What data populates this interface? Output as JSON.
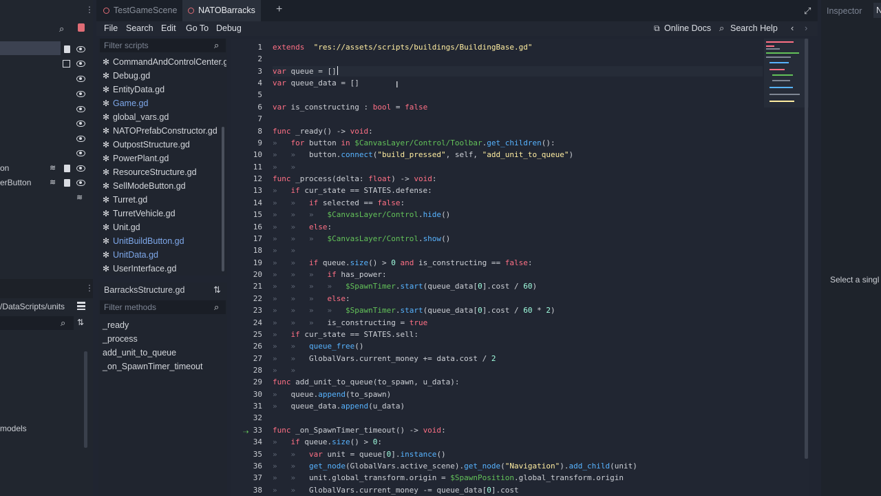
{
  "tabs": [
    {
      "label": "TestGameScene"
    },
    {
      "label": "NATOBarracks"
    }
  ],
  "menu": [
    "File",
    "Search",
    "Edit",
    "Go To",
    "Debug"
  ],
  "toolbar": {
    "online_docs": "Online Docs",
    "search_help": "Search Help"
  },
  "scene_dock": {
    "rows": [
      {
        "label": ""
      },
      {
        "label": ""
      },
      {
        "label": ""
      },
      {
        "label": ""
      },
      {
        "label": ""
      },
      {
        "label": ""
      },
      {
        "label": ""
      },
      {
        "label": ""
      },
      {
        "label": "on"
      },
      {
        "label": "erButton"
      },
      {
        "label": ""
      }
    ],
    "path_label": "/DataScripts/units",
    "folder_label": "models"
  },
  "scripts": {
    "filter_placeholder": "Filter scripts",
    "items": [
      {
        "label": "CommandAndControlCenter.gd"
      },
      {
        "label": "Debug.gd"
      },
      {
        "label": "EntityData.gd"
      },
      {
        "label": "Game.gd"
      },
      {
        "label": "global_vars.gd"
      },
      {
        "label": "NATOPrefabConstructor.gd"
      },
      {
        "label": "OutpostStructure.gd"
      },
      {
        "label": "PowerPlant.gd"
      },
      {
        "label": "ResourceStructure.gd"
      },
      {
        "label": "SellModeButton.gd"
      },
      {
        "label": "Turret.gd"
      },
      {
        "label": "TurretVehicle.gd"
      },
      {
        "label": "Unit.gd"
      },
      {
        "label": "UnitBuildButton.gd"
      },
      {
        "label": "UnitData.gd"
      },
      {
        "label": "UserInterface.gd"
      }
    ]
  },
  "methods": {
    "current_script": "BarracksStructure.gd",
    "filter_placeholder": "Filter methods",
    "items": [
      "_ready",
      "_process",
      "add_unit_to_queue",
      "_on_SpawnTimer_timeout"
    ]
  },
  "inspector": {
    "tab1": "Inspector",
    "tab2": "N",
    "hint": "Select a singl"
  },
  "code_lines": [
    {
      "n": "1"
    },
    {
      "n": "2"
    },
    {
      "n": "3"
    },
    {
      "n": "4"
    },
    {
      "n": "5"
    },
    {
      "n": "6"
    },
    {
      "n": "7"
    },
    {
      "n": "8"
    },
    {
      "n": "9"
    },
    {
      "n": "10"
    },
    {
      "n": "11"
    },
    {
      "n": "12"
    },
    {
      "n": "13"
    },
    {
      "n": "14"
    },
    {
      "n": "15"
    },
    {
      "n": "16"
    },
    {
      "n": "17"
    },
    {
      "n": "18"
    },
    {
      "n": "19"
    },
    {
      "n": "20"
    },
    {
      "n": "21"
    },
    {
      "n": "22"
    },
    {
      "n": "23"
    },
    {
      "n": "24"
    },
    {
      "n": "25"
    },
    {
      "n": "26"
    },
    {
      "n": "27"
    },
    {
      "n": "28"
    },
    {
      "n": "29"
    },
    {
      "n": "30"
    },
    {
      "n": "31"
    },
    {
      "n": "32"
    },
    {
      "n": "33"
    },
    {
      "n": "34"
    },
    {
      "n": "35"
    },
    {
      "n": "36"
    },
    {
      "n": "37"
    },
    {
      "n": "38"
    }
  ],
  "code_tokens": [
    [
      [
        "kw",
        "extends"
      ],
      [
        "",
        "  "
      ],
      [
        "str",
        "\"res://assets/scripts/buildings/BuildingBase.gd\""
      ]
    ],
    [],
    [
      [
        "kw",
        "var"
      ],
      [
        "",
        " queue = []"
      ]
    ],
    [
      [
        "kw",
        "var"
      ],
      [
        "",
        " queue_data = []"
      ]
    ],
    [],
    [
      [
        "kw",
        "var"
      ],
      [
        "",
        " is_constructing : "
      ],
      [
        "kw",
        "bool"
      ],
      [
        "",
        " = "
      ],
      [
        "kw",
        "false"
      ]
    ],
    [],
    [
      [
        "kw",
        "func"
      ],
      [
        "",
        " _ready() -> "
      ],
      [
        "kw",
        "void"
      ],
      [
        "",
        ":"
      ]
    ],
    [
      [
        "mut",
        "»   "
      ],
      [
        "kw",
        "for"
      ],
      [
        "",
        " button "
      ],
      [
        "kw",
        "in"
      ],
      [
        "",
        ""
      ],
      [
        "nd",
        " $CanvasLayer/Control/Toolbar"
      ],
      [
        "",
        "."
      ],
      [
        "fn",
        "get_children"
      ],
      [
        "",
        "():"
      ]
    ],
    [
      [
        "mut",
        "»   »   "
      ],
      [
        "",
        "button."
      ],
      [
        "fn",
        "connect"
      ],
      [
        "",
        "("
      ],
      [
        "str",
        "\"build_pressed\""
      ],
      [
        "",
        ", self, "
      ],
      [
        "str",
        "\"add_unit_to_queue\""
      ],
      [
        "",
        ")"
      ]
    ],
    [
      [
        "mut",
        "»   »"
      ]
    ],
    [
      [
        "kw",
        "func"
      ],
      [
        "",
        " _process(delta: "
      ],
      [
        "kw",
        "float"
      ],
      [
        "",
        ") -> "
      ],
      [
        "kw",
        "void"
      ],
      [
        "",
        ":"
      ]
    ],
    [
      [
        "mut",
        "»   "
      ],
      [
        "kw",
        "if"
      ],
      [
        "",
        " cur_state == STATES.defense:"
      ]
    ],
    [
      [
        "mut",
        "»   »   "
      ],
      [
        "kw",
        "if"
      ],
      [
        "",
        " selected == "
      ],
      [
        "kw",
        "false"
      ],
      [
        "",
        ":"
      ]
    ],
    [
      [
        "mut",
        "»   »   »   "
      ],
      [
        "nd",
        "$CanvasLayer/Control"
      ],
      [
        "",
        "."
      ],
      [
        "fn",
        "hide"
      ],
      [
        "",
        "()"
      ]
    ],
    [
      [
        "mut",
        "»   »   "
      ],
      [
        "kw",
        "else"
      ],
      [
        "",
        ":"
      ]
    ],
    [
      [
        "mut",
        "»   »   »   "
      ],
      [
        "nd",
        "$CanvasLayer/Control"
      ],
      [
        "",
        "."
      ],
      [
        "fn",
        "show"
      ],
      [
        "",
        "()"
      ]
    ],
    [
      [
        "mut",
        "»   »"
      ]
    ],
    [
      [
        "mut",
        "»   »   "
      ],
      [
        "kw",
        "if"
      ],
      [
        "",
        " queue."
      ],
      [
        "fn",
        "size"
      ],
      [
        "",
        "() > "
      ],
      [
        "num",
        "0"
      ],
      [
        "",
        ""
      ],
      [
        "kw",
        " and"
      ],
      [
        "",
        " is_constructing == "
      ],
      [
        "kw",
        "false"
      ],
      [
        "",
        ":"
      ]
    ],
    [
      [
        "mut",
        "»   »   »   "
      ],
      [
        "kw",
        "if"
      ],
      [
        "",
        " has_power:"
      ]
    ],
    [
      [
        "mut",
        "»   »   »   »   "
      ],
      [
        "nd",
        "$SpawnTimer"
      ],
      [
        "",
        "."
      ],
      [
        "fn",
        "start"
      ],
      [
        "",
        "(queue_data["
      ],
      [
        "num",
        "0"
      ],
      [
        "",
        "].cost / "
      ],
      [
        "num",
        "60"
      ],
      [
        "",
        ")"
      ]
    ],
    [
      [
        "mut",
        "»   »   »   "
      ],
      [
        "kw",
        "else"
      ],
      [
        "",
        ":"
      ]
    ],
    [
      [
        "mut",
        "»   »   »   »   "
      ],
      [
        "nd",
        "$SpawnTimer"
      ],
      [
        "",
        "."
      ],
      [
        "fn",
        "start"
      ],
      [
        "",
        "(queue_data["
      ],
      [
        "num",
        "0"
      ],
      [
        "",
        "].cost / "
      ],
      [
        "num",
        "60"
      ],
      [
        "",
        " * "
      ],
      [
        "num",
        "2"
      ],
      [
        "",
        ")"
      ]
    ],
    [
      [
        "mut",
        "»   »   »   "
      ],
      [
        "",
        "is_constructing = "
      ],
      [
        "kw",
        "true"
      ]
    ],
    [
      [
        "mut",
        "»   "
      ],
      [
        "kw",
        "if"
      ],
      [
        "",
        " cur_state == STATES.sell:"
      ]
    ],
    [
      [
        "mut",
        "»   »   "
      ],
      [
        "fn",
        "queue_free"
      ],
      [
        "",
        "()"
      ]
    ],
    [
      [
        "mut",
        "»   »   "
      ],
      [
        "",
        "GlobalVars.current_money += data.cost / "
      ],
      [
        "num",
        "2"
      ]
    ],
    [
      [
        "mut",
        "»   »"
      ]
    ],
    [
      [
        "kw",
        "func"
      ],
      [
        "",
        " add_unit_to_queue(to_spawn, u_data):"
      ]
    ],
    [
      [
        "mut",
        "»   "
      ],
      [
        "",
        "queue."
      ],
      [
        "fn",
        "append"
      ],
      [
        "",
        "(to_spawn)"
      ]
    ],
    [
      [
        "mut",
        "»   "
      ],
      [
        "",
        "queue_data."
      ],
      [
        "fn",
        "append"
      ],
      [
        "",
        "(u_data)"
      ]
    ],
    [],
    [
      [
        "kw",
        "func"
      ],
      [
        "",
        " _on_SpawnTimer_timeout() -> "
      ],
      [
        "kw",
        "void"
      ],
      [
        "",
        ":"
      ]
    ],
    [
      [
        "mut",
        "»   "
      ],
      [
        "kw",
        "if"
      ],
      [
        "",
        " queue."
      ],
      [
        "fn",
        "size"
      ],
      [
        "",
        "() > "
      ],
      [
        "num",
        "0"
      ],
      [
        "",
        ":"
      ]
    ],
    [
      [
        "mut",
        "»   »   "
      ],
      [
        "kw",
        "var"
      ],
      [
        "",
        " unit = queue["
      ],
      [
        "num",
        "0"
      ],
      [
        "",
        "]."
      ],
      [
        "fn",
        "instance"
      ],
      [
        "",
        "()"
      ]
    ],
    [
      [
        "mut",
        "»   »   "
      ],
      [
        "fn",
        "get_node"
      ],
      [
        "",
        "(GlobalVars.active_scene)."
      ],
      [
        "fn",
        "get_node"
      ],
      [
        "",
        "("
      ],
      [
        "str",
        "\"Navigation\""
      ],
      [
        "",
        ")."
      ],
      [
        "fn",
        "add_child"
      ],
      [
        "",
        "(unit)"
      ]
    ],
    [
      [
        "mut",
        "»   »   "
      ],
      [
        "",
        "unit.global_transform.origin = "
      ],
      [
        "nd",
        "$SpawnPosition"
      ],
      [
        "",
        ".global_transform.origin"
      ]
    ],
    [
      [
        "mut",
        "»   »   "
      ],
      [
        "",
        "GlobalVars.current_money -= queue_data["
      ],
      [
        "num",
        "0"
      ],
      [
        "",
        "].cost"
      ]
    ]
  ],
  "colors": {
    "accent": "#70bafa",
    "keyword": "#ff7085",
    "string": "#ffeda1",
    "number": "#a1ffe0",
    "node_path": "#63c259",
    "function": "#57b3ff"
  },
  "icons": [
    "search-icon",
    "script-add-icon",
    "eye-icon",
    "script-icon",
    "signal-icon",
    "gear-icon",
    "sort-icon",
    "fullscreen-icon",
    "external-link-icon",
    "chevron-left-icon",
    "chevron-right-icon",
    "plus-icon",
    "grid-icon"
  ]
}
